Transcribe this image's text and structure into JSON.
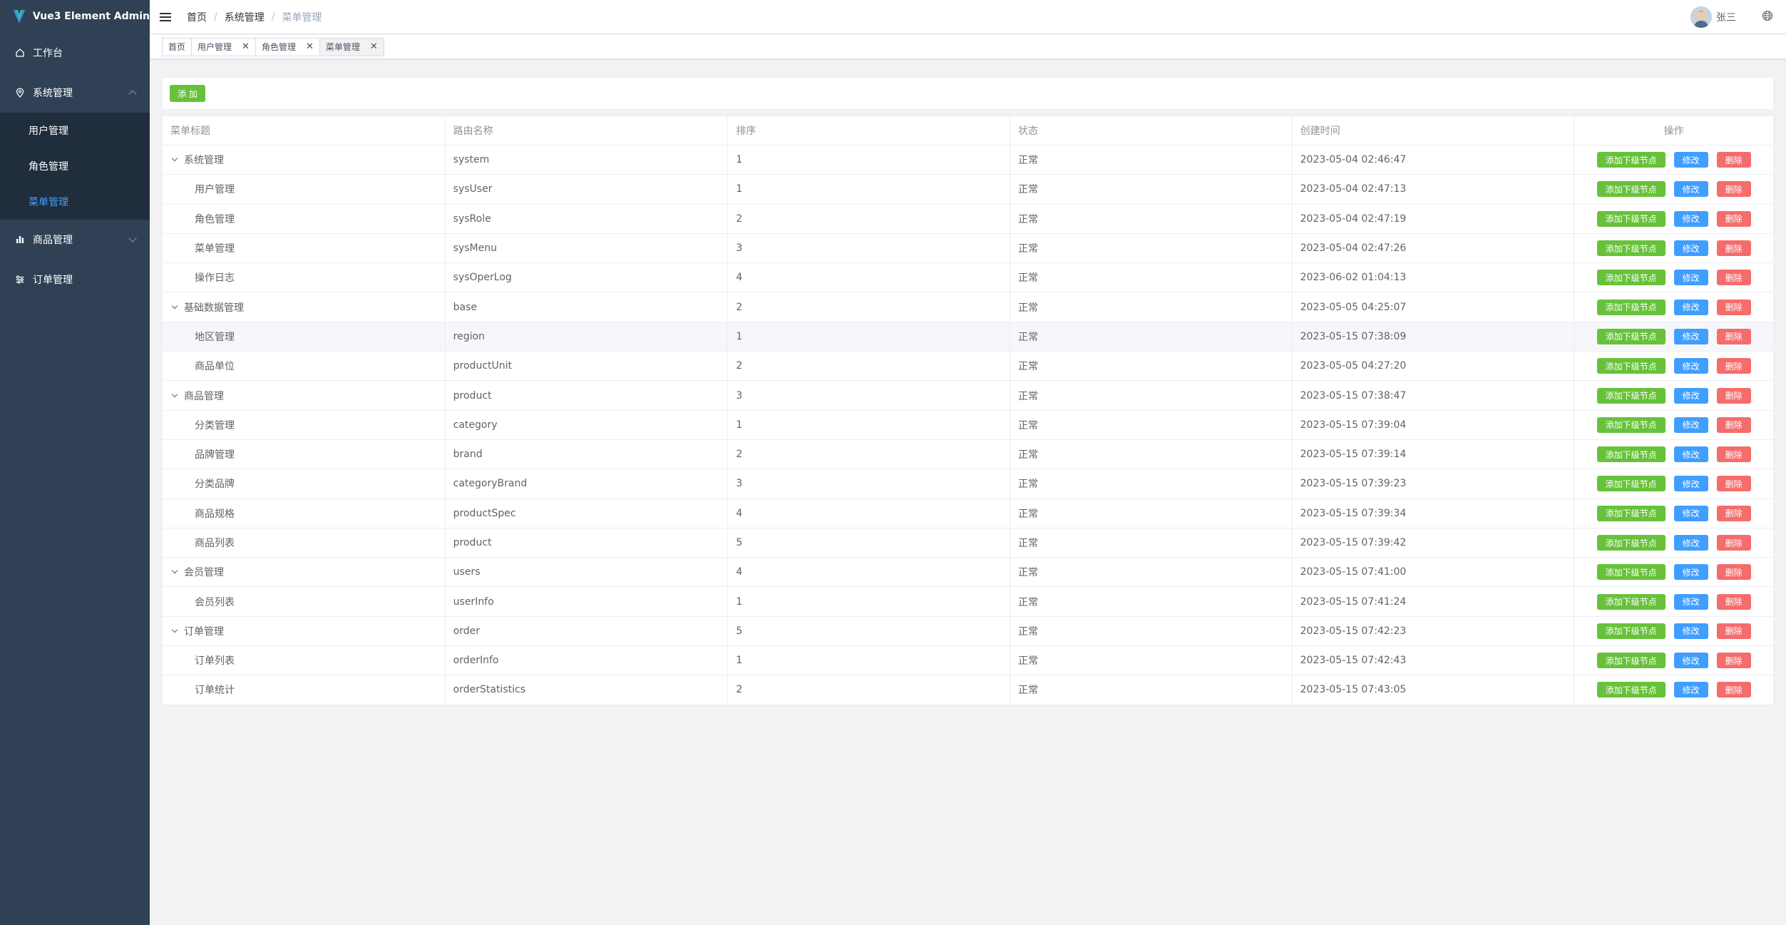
{
  "app": {
    "title": "Vue3 Element Admin"
  },
  "sidebar": {
    "items": [
      {
        "label": "工作台"
      },
      {
        "label": "系统管理",
        "children": [
          {
            "label": "用户管理"
          },
          {
            "label": "角色管理"
          },
          {
            "label": "菜单管理",
            "active": true
          }
        ]
      },
      {
        "label": "商品管理"
      },
      {
        "label": "订单管理"
      }
    ]
  },
  "header": {
    "breadcrumb": [
      "首页",
      "系统管理",
      "菜单管理"
    ],
    "separator": "/",
    "username": "张三"
  },
  "tags": [
    {
      "label": "首页",
      "closable": false
    },
    {
      "label": "用户管理",
      "closable": true
    },
    {
      "label": "角色管理",
      "closable": true
    },
    {
      "label": "菜单管理",
      "closable": true,
      "active": true
    }
  ],
  "toolbar": {
    "add_label": "添 加"
  },
  "table": {
    "columns": [
      "菜单标题",
      "路由名称",
      "排序",
      "状态",
      "创建时间",
      "操作"
    ],
    "actions": {
      "add_child": "添加下级节点",
      "edit": "修改",
      "delete": "删除"
    },
    "rows": [
      {
        "title": "系统管理",
        "route": "system",
        "sort": "1",
        "status": "正常",
        "created": "2023-05-04 02:46:47",
        "level": 0,
        "expand": true
      },
      {
        "title": "用户管理",
        "route": "sysUser",
        "sort": "1",
        "status": "正常",
        "created": "2023-05-04 02:47:13",
        "level": 1
      },
      {
        "title": "角色管理",
        "route": "sysRole",
        "sort": "2",
        "status": "正常",
        "created": "2023-05-04 02:47:19",
        "level": 1
      },
      {
        "title": "菜单管理",
        "route": "sysMenu",
        "sort": "3",
        "status": "正常",
        "created": "2023-05-04 02:47:26",
        "level": 1
      },
      {
        "title": "操作日志",
        "route": "sysOperLog",
        "sort": "4",
        "status": "正常",
        "created": "2023-06-02 01:04:13",
        "level": 1
      },
      {
        "title": "基础数据管理",
        "route": "base",
        "sort": "2",
        "status": "正常",
        "created": "2023-05-05 04:25:07",
        "level": 0,
        "expand": true
      },
      {
        "title": "地区管理",
        "route": "region",
        "sort": "1",
        "status": "正常",
        "created": "2023-05-15 07:38:09",
        "level": 1,
        "hover": true
      },
      {
        "title": "商品单位",
        "route": "productUnit",
        "sort": "2",
        "status": "正常",
        "created": "2023-05-05 04:27:20",
        "level": 1
      },
      {
        "title": "商品管理",
        "route": "product",
        "sort": "3",
        "status": "正常",
        "created": "2023-05-15 07:38:47",
        "level": 0,
        "expand": true
      },
      {
        "title": "分类管理",
        "route": "category",
        "sort": "1",
        "status": "正常",
        "created": "2023-05-15 07:39:04",
        "level": 1
      },
      {
        "title": "品牌管理",
        "route": "brand",
        "sort": "2",
        "status": "正常",
        "created": "2023-05-15 07:39:14",
        "level": 1
      },
      {
        "title": "分类品牌",
        "route": "categoryBrand",
        "sort": "3",
        "status": "正常",
        "created": "2023-05-15 07:39:23",
        "level": 1
      },
      {
        "title": "商品规格",
        "route": "productSpec",
        "sort": "4",
        "status": "正常",
        "created": "2023-05-15 07:39:34",
        "level": 1
      },
      {
        "title": "商品列表",
        "route": "product",
        "sort": "5",
        "status": "正常",
        "created": "2023-05-15 07:39:42",
        "level": 1
      },
      {
        "title": "会员管理",
        "route": "users",
        "sort": "4",
        "status": "正常",
        "created": "2023-05-15 07:41:00",
        "level": 0,
        "expand": true
      },
      {
        "title": "会员列表",
        "route": "userInfo",
        "sort": "1",
        "status": "正常",
        "created": "2023-05-15 07:41:24",
        "level": 1
      },
      {
        "title": "订单管理",
        "route": "order",
        "sort": "5",
        "status": "正常",
        "created": "2023-05-15 07:42:23",
        "level": 0,
        "expand": true
      },
      {
        "title": "订单列表",
        "route": "orderInfo",
        "sort": "1",
        "status": "正常",
        "created": "2023-05-15 07:42:43",
        "level": 1
      },
      {
        "title": "订单统计",
        "route": "orderStatistics",
        "sort": "2",
        "status": "正常",
        "created": "2023-05-15 07:43:05",
        "level": 1
      }
    ]
  },
  "colors": {
    "sidebar_bg": "#304156",
    "submenu_bg": "#1f2d3d",
    "primary": "#409eff",
    "success": "#67c23a",
    "danger": "#f56c6c"
  },
  "icons": {
    "logo": "vue-logo-icon",
    "menu_toggle": "hamburger-icon",
    "language": "globe-icon",
    "dashboard": "home-icon",
    "system": "location-pin-icon",
    "product": "bar-chart-icon",
    "order": "sliders-icon"
  }
}
